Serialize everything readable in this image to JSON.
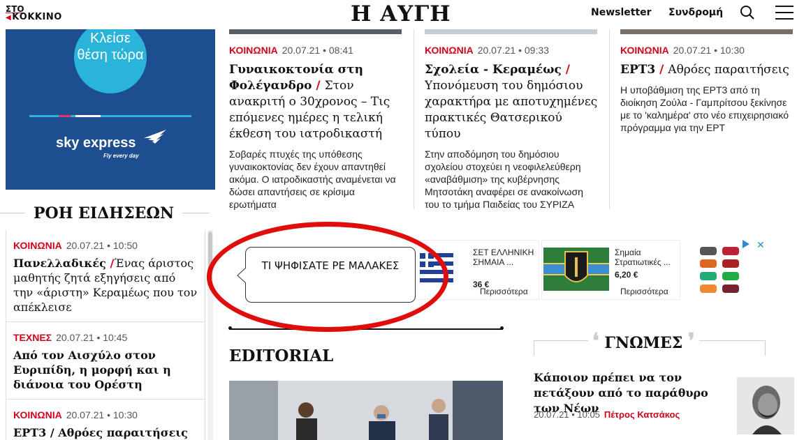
{
  "header": {
    "sto_logo_line1": "ΣΤΟ",
    "sto_logo_line2": "ΚΟΚΚΙΝΟ",
    "brand": "Η ΑΥΓΗ",
    "newsletter": "Newsletter",
    "subscription": "Συνδρομή"
  },
  "sidebar_ad": {
    "cta": "Κλείσε θέση τώρα",
    "brand": "sky express",
    "tagline": "Fly every day"
  },
  "top_articles": [
    {
      "category": "ΚΟΙΝΩΝΙΑ",
      "datetime": "20.07.21 • 08:41",
      "title": "Γυναικοκτονία στη Φολέγανδρο",
      "subtitle": "Στον ανακριτή ο 30χρονος – Τις επόμενες ημέρες η τελική έκθεση του ιατροδικαστή",
      "lead": "Σοβαρές πτυχές της υπόθεσης γυναικοκτονίας δεν έχουν απαντηθεί ακόμα. Ο ιατροδικαστής αναμένεται να δώσει απαντήσεις σε κρίσιμα ερωτήματα"
    },
    {
      "category": "ΚΟΙΝΩΝΙΑ",
      "datetime": "20.07.21 • 09:33",
      "title": "Σχολεία - Κεραμέως",
      "subtitle": "Υπονόμευση του δημόσιου χαρακτήρα με αποτυχημένες πρακτικές Θατσερικού τύπου",
      "lead": "Στην αποδόμηση του δημόσιου σχολείου στοχεύει η νεοφιλελεύθερη «αναβάθμιση» της κυβέρνησης Μητσοτάκη αναφέρει σε ανακοίνωση του το τμήμα Παιδείας του ΣΥΡΙΖΑ"
    },
    {
      "category": "ΚΟΙΝΩΝΙΑ",
      "datetime": "20.07.21 • 10:30",
      "title": "ΕΡΤ3",
      "subtitle": "Αθρόες παραιτήσεις",
      "lead": "Η υποβάθμιση της ΕΡΤ3 από τη διοίκηση Ζούλα - Γαμπρίτσου ξεκίνησε με το 'καλημέρα' στο νέο επιχειρησιακό πρόγραμμα για την ΕΡΤ"
    }
  ],
  "news_feed": {
    "title": "ΡΟΗ ΕΙΔΗΣΕΩΝ",
    "items": [
      {
        "category": "ΚΟΙΝΩΝΙΑ",
        "datetime": "20.07.21 • 10:50",
        "title": "Πανελλαδικές",
        "subtitle": "Ένας άριστος μαθητής ζητά εξηγήσεις από την «άριστη» Κεραμέως που τον απέκλεισε"
      },
      {
        "category": "ΤΕΧΝΕΣ",
        "datetime": "20.07.21 • 10:45",
        "title": "Από τον Αισχύλο στον Ευριπίδη, η μορφή και η διάνοια του Ορέστη",
        "subtitle": ""
      },
      {
        "category": "ΚΟΙΝΩΝΙΑ",
        "datetime": "20.07.21 • 10:30",
        "title": "ΕΡΤ3 / Αθρόες παραιτήσεις",
        "subtitle": ""
      }
    ]
  },
  "annotation": {
    "callout_text": "ΤΙ ΨΗΦΙΣΑΤΕ ΡΕ ΜΑΛΑΚΕΣ"
  },
  "ad_strip": {
    "cards": [
      {
        "name": "ΣΕΤ ΕΛΛΗΝΙΚΗ ΣΗΜΑΙΑ ...",
        "price": "36 €",
        "more": "Περισσότερα"
      },
      {
        "name": "Σημαία Στρατιωτικές ...",
        "price": "6,20 €",
        "more": "Περισσότερα"
      }
    ],
    "close": "✕"
  },
  "editorial": {
    "title": "EDITORIAL"
  },
  "opinions": {
    "title": "ΓΝΩΜΕΣ",
    "headline": "Κάποιον πρέπει να τον πετάξουν από το παράθυρο των Νέων",
    "datetime": "20.07.21 • 10:05",
    "author": "Πέτρος Κατσάκος"
  },
  "colors": {
    "accent_red": "#d0021b",
    "ad_blue": "#1d4e8f",
    "ad_cyan": "#2bb4d9",
    "annotation_red": "#e00d0d"
  }
}
